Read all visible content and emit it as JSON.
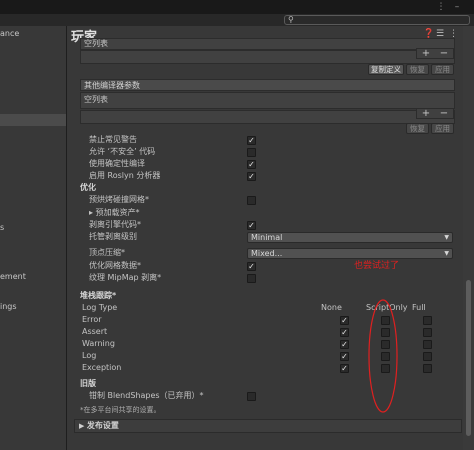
{
  "search": {
    "placeholder": ""
  },
  "sidebar": {
    "items": [
      {
        "label": "ance"
      },
      {
        "label": ""
      },
      {
        "label": "s"
      },
      {
        "label": "ement"
      },
      {
        "label": "ings"
      }
    ]
  },
  "header": {
    "title": "玩家"
  },
  "lists": {
    "top_empty": "空列表",
    "copy_defs": "复制定义",
    "revert": "恢复",
    "apply": "应用",
    "other_args": "其他编译器参数",
    "empty": "空列表",
    "revert2": "恢复",
    "apply2": "应用"
  },
  "compiler": {
    "rows": [
      {
        "label": "禁止常见警告",
        "checked": true
      },
      {
        "label": "允许 ‘不安全’ 代码",
        "checked": false
      },
      {
        "label": "使用确定性编译",
        "checked": true
      },
      {
        "label": "启用 Roslyn 分析器",
        "checked": true
      }
    ]
  },
  "optimization": {
    "title": "优化",
    "rows": [
      {
        "label": "预烘烤碰撞网格*",
        "checked": false
      },
      {
        "label": "▸ 预加载资产*",
        "checked": null
      },
      {
        "label": "剥离引擎代码*",
        "checked": true
      },
      {
        "label": "托管剥离级别",
        "dropdown": "Minimal"
      },
      {
        "label": "顶点压缩*",
        "dropdown": "Mixed..."
      },
      {
        "label": "优化网格数据*",
        "checked": true
      },
      {
        "label": "纹理 MipMap 剥离*",
        "checked": false
      }
    ]
  },
  "stack_trace": {
    "title": "堆栈跟踪*",
    "log_type_label": "Log Type",
    "columns": [
      "None",
      "ScriptOnly",
      "Full"
    ],
    "rows": [
      {
        "label": "Error",
        "values": [
          true,
          false,
          false
        ]
      },
      {
        "label": "Assert",
        "values": [
          true,
          false,
          false
        ]
      },
      {
        "label": "Warning",
        "values": [
          true,
          false,
          false
        ]
      },
      {
        "label": "Log",
        "values": [
          true,
          false,
          false
        ]
      },
      {
        "label": "Exception",
        "values": [
          true,
          false,
          false
        ]
      }
    ]
  },
  "legacy": {
    "title": "旧版",
    "clamp_label": "钳制 BlendShapes（已弃用）*",
    "clamp_checked": false,
    "note": "*在多平台间共享的设置。"
  },
  "publish": {
    "label": "发布设置"
  },
  "annotation": {
    "text": "也尝试过了",
    "color": "#e02020"
  },
  "colors": {
    "background": "#383838",
    "topbar": "#191919",
    "panel": "#414141"
  }
}
